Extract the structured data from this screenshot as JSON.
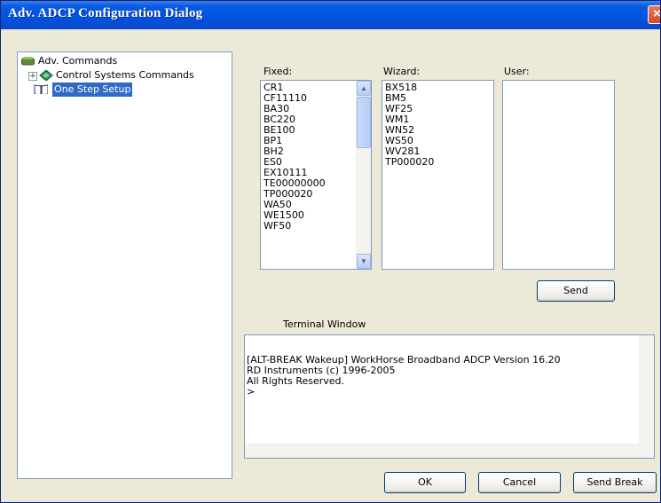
{
  "window": {
    "title": "Adv. ADCP Configuration Dialog",
    "close_glyph": "×"
  },
  "tree": {
    "items": [
      {
        "label": "Adv. Commands",
        "icon": "folder-icon"
      },
      {
        "label": "Control Systems Commands",
        "icon": "gear-icon",
        "expander": "+"
      },
      {
        "label": "One Step Setup",
        "icon": "book-icon",
        "selected": true
      }
    ]
  },
  "lists": {
    "fixed": {
      "label": "Fixed:",
      "items": [
        "CR1",
        "CF11110",
        "BA30",
        "BC220",
        "BE100",
        "BP1",
        "BH2",
        "ES0",
        "EX10111",
        "TE00000000",
        "TP000020",
        "WA50",
        "WE1500",
        "WF50"
      ]
    },
    "wizard": {
      "label": "Wizard:",
      "items": [
        "BX518",
        "BM5",
        "WF25",
        "WM1",
        "WN52",
        "WS50",
        "WV281",
        "TP000020"
      ]
    },
    "user": {
      "label": "User:",
      "items": []
    }
  },
  "buttons": {
    "send": "Send",
    "ok": "OK",
    "cancel": "Cancel",
    "send_break": "Send Break"
  },
  "terminal": {
    "caption": "Terminal Window",
    "lines": [
      "[ALT-BREAK Wakeup] WorkHorse Broadband ADCP Version 16.20",
      "RD Instruments (c) 1996-2005",
      "All Rights Reserved.",
      ">"
    ]
  },
  "colors": {
    "title_blue": "#0054e3",
    "selection": "#316ac5",
    "dialog_bg": "#ece9d8"
  }
}
